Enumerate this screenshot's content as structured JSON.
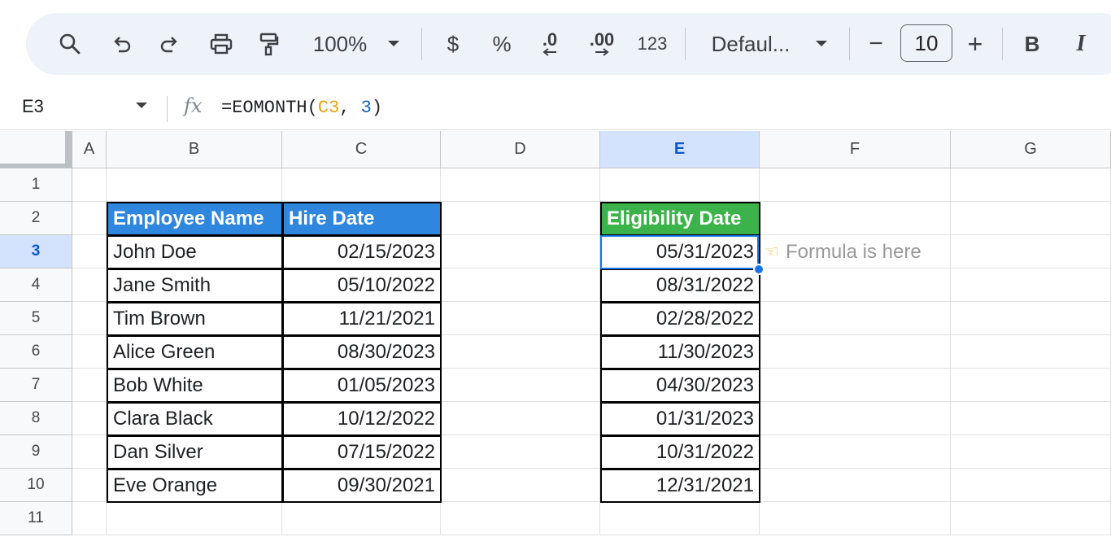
{
  "toolbar": {
    "zoom": "100%",
    "currency": "$",
    "percent": "%",
    "decrease_decimal": ".0",
    "increase_decimal": ".00",
    "number_format": "123",
    "font": "Defaul...",
    "font_size": "10",
    "bold": "B",
    "italic": "I",
    "minus": "−",
    "plus": "+"
  },
  "formula_bar": {
    "name_box": "E3",
    "fx": "fx",
    "formula_prefix": "=EOMONTH(",
    "formula_ref": "C3",
    "formula_mid": ", ",
    "formula_num": "3",
    "formula_suffix": ")"
  },
  "columns": [
    "A",
    "B",
    "C",
    "D",
    "E",
    "F",
    "G"
  ],
  "rows": [
    "1",
    "2",
    "3",
    "4",
    "5",
    "6",
    "7",
    "8",
    "9",
    "10",
    "11"
  ],
  "table": {
    "header_name": "Employee Name",
    "header_hire": "Hire Date",
    "header_elig": "Eligibility Date",
    "names": [
      "John Doe",
      "Jane Smith",
      "Tim Brown",
      "Alice Green",
      "Bob White",
      "Clara Black",
      "Dan Silver",
      "Eve Orange"
    ],
    "hire_dates": [
      "02/15/2023",
      "05/10/2022",
      "11/21/2021",
      "08/30/2023",
      "01/05/2023",
      "10/12/2022",
      "07/15/2022",
      "09/30/2021"
    ],
    "eligibility_dates": [
      "05/31/2023",
      "08/31/2022",
      "02/28/2022",
      "11/30/2023",
      "04/30/2023",
      "01/31/2023",
      "10/31/2022",
      "12/31/2021"
    ]
  },
  "note": "Formula is here",
  "colors": {
    "header_blue": "#2e86de",
    "header_green": "#3cb34a",
    "selection": "#1a73e8"
  }
}
